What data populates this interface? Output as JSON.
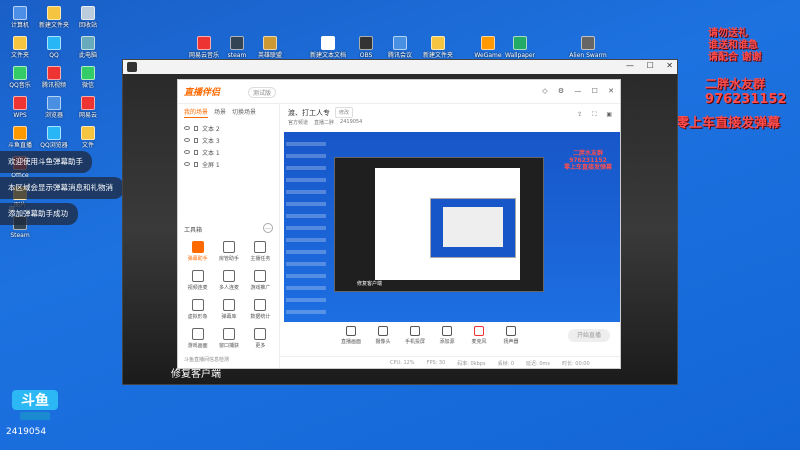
{
  "desktop_icons_left": [
    {
      "label": "计算机",
      "color": "#4d8fe6"
    },
    {
      "label": "新建文件夹",
      "color": "#f5c542"
    },
    {
      "label": "回收站",
      "color": "#bcd"
    },
    {
      "label": "文件夹",
      "color": "#f5c542"
    },
    {
      "label": "QQ",
      "color": "#29b6f6"
    },
    {
      "label": "此电脑",
      "color": "#6ab"
    },
    {
      "label": "QQ音乐",
      "color": "#3c6"
    },
    {
      "label": "腾讯视频",
      "color": "#e33"
    },
    {
      "label": "微信",
      "color": "#3c6"
    },
    {
      "label": "WPS",
      "color": "#e33"
    },
    {
      "label": "浏览器",
      "color": "#4a90e2"
    },
    {
      "label": "网易云",
      "color": "#e33"
    },
    {
      "label": "斗鱼直播",
      "color": "#f90"
    },
    {
      "label": "QQ浏览器",
      "color": "#29b6f6"
    },
    {
      "label": "文件",
      "color": "#f5c542"
    },
    {
      "label": "Office",
      "color": "#d44"
    },
    {
      "label": "下载",
      "color": "#f5c542"
    },
    {
      "label": "网盘",
      "color": "#4a90e2"
    },
    {
      "label": "图片",
      "color": "#f5c542"
    },
    {
      "label": "视频",
      "color": "#f5c542"
    },
    {
      "label": "文档",
      "color": "#f5c542"
    },
    {
      "label": "Steam",
      "color": "#345"
    },
    {
      "label": "Chrome",
      "color": "#e33"
    },
    {
      "label": "游戏",
      "color": "#7a5"
    }
  ],
  "desktop_icons_top": [
    {
      "label": "网易云音乐",
      "color": "#e33"
    },
    {
      "label": "steam",
      "color": "#345"
    },
    {
      "label": "英雄联盟",
      "color": "#c93"
    },
    {
      "label": "新建文本文档",
      "color": "#fff"
    },
    {
      "label": "OBS",
      "color": "#333"
    },
    {
      "label": "腾讯会议",
      "color": "#4a90e2"
    },
    {
      "label": "新建文件夹",
      "color": "#f5c542"
    },
    {
      "label": "WeGame",
      "color": "#f90"
    },
    {
      "label": "Wallpaper",
      "color": "#2a6"
    },
    {
      "label": "Alien Swarm",
      "color": "#666"
    }
  ],
  "overlay": {
    "gift_line1": "请勿送礼",
    "gift_line2": "谁送和谁急",
    "gift_line3": "请配合 谢谢",
    "fan_group": "二胖水友群",
    "qq_number": "976231152",
    "danmaku_hint": "零上车直接发弹幕"
  },
  "notices": [
    "欢迎使用斗鱼弹幕助手",
    "本区域会显示弹幕消息和礼物消息",
    "添加弹幕助手成功"
  ],
  "stream_window": {
    "caption": "修复客户端"
  },
  "app": {
    "logo_text": "直播伴侣",
    "version": "测试版",
    "tabs": [
      "我的场景",
      "场景",
      "切换场景"
    ],
    "scenes": [
      "文本 2",
      "文本 3",
      "文本 1",
      "全屏 1"
    ],
    "toolbox_title": "工具箱",
    "tools": [
      {
        "label": "弹幕助手",
        "highlight": true
      },
      {
        "label": "房管助手",
        "highlight": false
      },
      {
        "label": "主播任务",
        "highlight": false
      },
      {
        "label": "视频连麦",
        "highlight": false
      },
      {
        "label": "多人连麦",
        "highlight": false
      },
      {
        "label": "游戏推广",
        "highlight": false
      },
      {
        "label": "虚拟形象",
        "highlight": false
      },
      {
        "label": "弹幕库",
        "highlight": false
      },
      {
        "label": "数据统计",
        "highlight": false
      },
      {
        "label": "游戏画面",
        "highlight": false
      },
      {
        "label": "窗口捕获",
        "highlight": false
      },
      {
        "label": "更多",
        "highlight": false
      }
    ],
    "bottom_left": "斗鱼直播间信息检测",
    "room_title": "渡、打工人专",
    "room_edit": "修改",
    "room_info": [
      "官方频道",
      "直播二胖",
      "2419054"
    ],
    "preview_red_line1": "二胖水友群",
    "preview_red_line2": "976231152",
    "preview_red_line3": "零上车直接发弹幕",
    "preview_caption": "修复客户端",
    "main_toolbar": [
      {
        "label": "直播画面",
        "red": false
      },
      {
        "label": "摄像头",
        "red": false
      },
      {
        "label": "手机投屏",
        "red": false
      },
      {
        "label": "添加源",
        "red": false
      },
      {
        "label": "麦克风",
        "red": true
      },
      {
        "label": "扬声器",
        "red": false
      }
    ],
    "start_button": "开始直播",
    "status": [
      "CPU: 12%",
      "FPS: 30",
      "码率: 0kbps",
      "丢帧: 0",
      "延迟: 0ms",
      "时长: 00:00"
    ]
  },
  "room_id": "2419054"
}
